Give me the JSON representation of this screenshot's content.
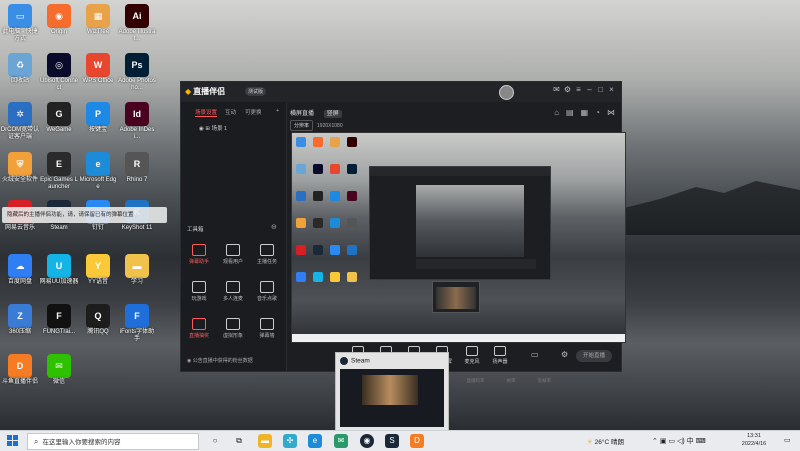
{
  "desktop": {
    "icons": [
      {
        "label": "此电脑 - 快捷方式",
        "name": "this-pc-icon",
        "color": "#3a8ee6",
        "glyph": "▭"
      },
      {
        "label": "Origin",
        "name": "origin-icon",
        "color": "#f56c2d",
        "glyph": "◉"
      },
      {
        "label": "WizTree",
        "name": "wiztree-icon",
        "color": "#e8a24a",
        "glyph": "▦"
      },
      {
        "label": "Adobe Illustrat...",
        "name": "illustrator-icon",
        "color": "#330000",
        "glyph": "Ai"
      },
      {
        "label": "回收站",
        "name": "recycle-bin-icon",
        "color": "#6aa5d6",
        "glyph": "♻"
      },
      {
        "label": "Ubisoft Connect",
        "name": "ubisoft-icon",
        "color": "#0a0a2a",
        "glyph": "◎"
      },
      {
        "label": "WPS Office",
        "name": "wps-icon",
        "color": "#e8472f",
        "glyph": "W"
      },
      {
        "label": "Adobe Photosho...",
        "name": "photoshop-icon",
        "color": "#001e36",
        "glyph": "Ps"
      },
      {
        "label": "DrCOM宽带认证客户端",
        "name": "drcom-icon",
        "color": "#2b6fc2",
        "glyph": "✲"
      },
      {
        "label": "WeGame",
        "name": "wegame-icon",
        "color": "#222",
        "glyph": "G"
      },
      {
        "label": "按键宝",
        "name": "anjianbao-icon",
        "color": "#1e88e5",
        "glyph": "P"
      },
      {
        "label": "Adobe InDesi...",
        "name": "indesign-icon",
        "color": "#49021f",
        "glyph": "Id"
      },
      {
        "label": "火绒安全软件",
        "name": "huorong-icon",
        "color": "#f2a13a",
        "glyph": "⛨"
      },
      {
        "label": "Epic Games Launcher",
        "name": "epic-games-icon",
        "color": "#2a2a2a",
        "glyph": "E"
      },
      {
        "label": "Microsoft Edge",
        "name": "edge-icon",
        "color": "#1c8bd8",
        "glyph": "e"
      },
      {
        "label": "Rhino 7",
        "name": "rhino-icon",
        "color": "#555",
        "glyph": "R"
      },
      {
        "label": "网易云音乐",
        "name": "netease-music-icon",
        "color": "#d91f26",
        "glyph": "♫"
      },
      {
        "label": "Steam",
        "name": "steam-icon",
        "color": "#1b2838",
        "glyph": "S"
      },
      {
        "label": "钉钉",
        "name": "dingtalk-icon",
        "color": "#2a8af5",
        "glyph": "✈"
      },
      {
        "label": "KeyShot 11",
        "name": "keyshot-icon",
        "color": "#1f72c4",
        "glyph": "K"
      },
      {
        "label": "百度网盘",
        "name": "baidu-netdisk-icon",
        "color": "#2f7ef3",
        "glyph": "☁"
      },
      {
        "label": "网易UU加速器",
        "name": "uu-accelerator-icon",
        "color": "#14b4e6",
        "glyph": "U"
      },
      {
        "label": "YY语音",
        "name": "yy-voice-icon",
        "color": "#f9c93a",
        "glyph": "Y"
      },
      {
        "label": "学习",
        "name": "folder-study-icon",
        "color": "#f0c14b",
        "glyph": "▬"
      },
      {
        "label": "360压缩",
        "name": "360zip-icon",
        "color": "#3a7bd5",
        "glyph": "Z"
      },
      {
        "label": "FUNGTrai...",
        "name": "fungtrai-icon",
        "color": "#111",
        "glyph": "F"
      },
      {
        "label": "腾讯QQ",
        "name": "qq-icon",
        "color": "#1d1d1d",
        "glyph": "Q"
      },
      {
        "label": "iFonts字体助手",
        "name": "ifonts-icon",
        "color": "#1e6fd9",
        "glyph": "F"
      },
      {
        "label": "斗鱼直播伴侣",
        "name": "douyu-icon",
        "color": "#f57c22",
        "glyph": "D"
      },
      {
        "label": "微信",
        "name": "wechat-icon",
        "color": "#2dc100",
        "glyph": "✉"
      }
    ],
    "toast": "隐藏后的主播伴侣功能，请，请保留已有的弹幕位置"
  },
  "app": {
    "title": "直播伴侣",
    "version": "测试版",
    "left_tabs": [
      "场景设置",
      "互动",
      "可更换"
    ],
    "scene_name": "场景 1",
    "tools_header": "工具箱",
    "tools": [
      {
        "label": "弹幕助手",
        "red": true
      },
      {
        "label": "观看用户",
        "red": false
      },
      {
        "label": "主播任务",
        "red": false
      },
      {
        "label": "玩游戏",
        "red": false
      },
      {
        "label": "多人连麦",
        "red": false
      },
      {
        "label": "音乐点歌",
        "red": false
      },
      {
        "label": "直播抽奖",
        "red": true
      },
      {
        "label": "虚拟形象",
        "red": false
      },
      {
        "label": "弹幕墙",
        "red": false
      }
    ],
    "left_footer": "公告直播中获得的粉丝数据",
    "center_tabs": [
      "横屏直播",
      "竖屏"
    ],
    "subbar_pill": "分辨率",
    "subbar_text": "1920X1080",
    "bottom_tools": [
      "窗口录屏",
      "摄像头",
      "手机投屏",
      "游戏投屏",
      "麦克风",
      "扬声器"
    ],
    "start_button": "开始直播",
    "status_items": [
      "CPU占用",
      "内存占用",
      "直播码率",
      "帧率",
      "丢帧率"
    ]
  },
  "steam_popup": {
    "title": "Steam"
  },
  "taskbar": {
    "search_placeholder": "在这里输入你要搜索的内容",
    "weather": "26°C 晴朗",
    "time": "13:31",
    "date": "2022/4/16",
    "ime": "中"
  }
}
